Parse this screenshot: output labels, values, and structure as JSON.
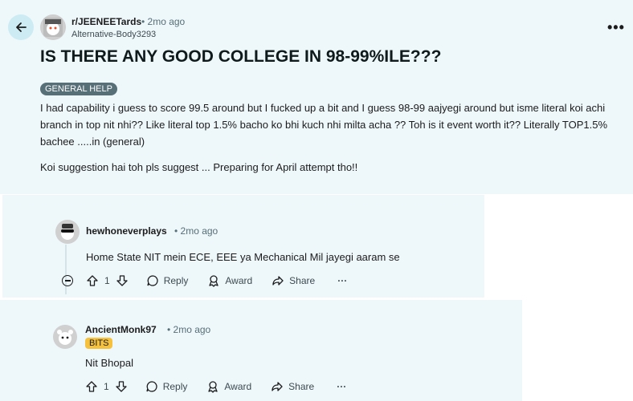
{
  "post": {
    "subreddit": "r/JEENEETards",
    "time": "• 2mo ago",
    "author": "Alternative-Body3293",
    "title": "IS THERE ANY GOOD COLLEGE IN 98-99%ILE???",
    "flair": "GENERAL HELP",
    "body_p1": "I had capability i guess to score 99.5 around but I fucked up a bit and I guess 98-99 aajyegi around but isme literal koi achi branch in top nit nhi?? Like literal top 1.5% bacho ko bhi kuch nhi milta acha ?? Toh is it event worth it?? Literally TOP1.5% bachee .....in (general)",
    "body_p2": "Koi suggestion hai toh pls suggest ... Preparing for April attempt tho!!",
    "more": "•••"
  },
  "comments": [
    {
      "user": "hewhoneverplays",
      "time": "• 2mo ago",
      "body": "Home State NIT mein ECE, EEE ya Mechanical Mil jayegi aaram se",
      "votes": "1",
      "reply": "Reply",
      "award": "Award",
      "share": "Share",
      "more": "···"
    },
    {
      "user": "AncientMonk97",
      "time": "• 2mo ago",
      "flair": "BITS",
      "body": "Nit Bhopal",
      "votes": "1",
      "reply": "Reply",
      "award": "Award",
      "share": "Share",
      "more": "···"
    }
  ],
  "colors": {
    "thread_bg": "#eef8fb",
    "flair_general": "#576f76",
    "flair_bits": "#f6c23e",
    "back_button": "#cdebf3"
  }
}
